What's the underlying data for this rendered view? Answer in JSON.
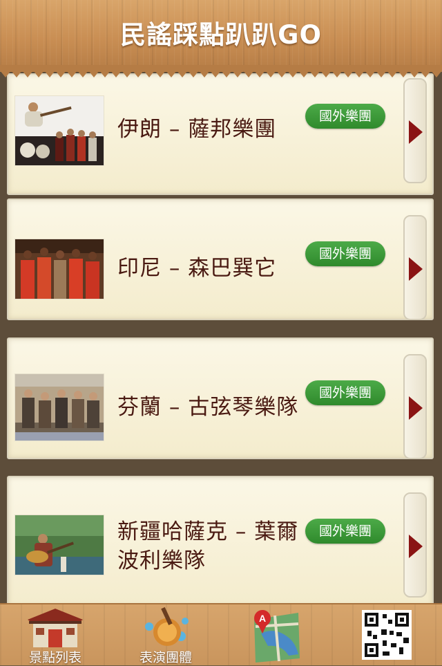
{
  "header": {
    "title": "民謠踩點趴趴GO"
  },
  "items": [
    {
      "title": "伊朗 – 薩邦樂團",
      "badge": "國外樂團"
    },
    {
      "title": "印尼 – 森巴巽它",
      "badge": "國外樂團"
    },
    {
      "title": "芬蘭 – 古弦琴樂隊",
      "badge": "國外樂團"
    },
    {
      "title": "新疆哈薩克 – 葉爾波利樂隊",
      "badge": "國外樂團"
    }
  ],
  "tabs": [
    {
      "label": "景點列表",
      "icon": "temple-icon"
    },
    {
      "label": "表演團體",
      "icon": "instrument-icon"
    },
    {
      "label": "",
      "icon": "map-icon"
    },
    {
      "label": "",
      "icon": "qrcode-icon"
    }
  ],
  "colors": {
    "badge": "#3a9a37",
    "title_text": "#4a1a12",
    "arrow": "#8a1414"
  }
}
